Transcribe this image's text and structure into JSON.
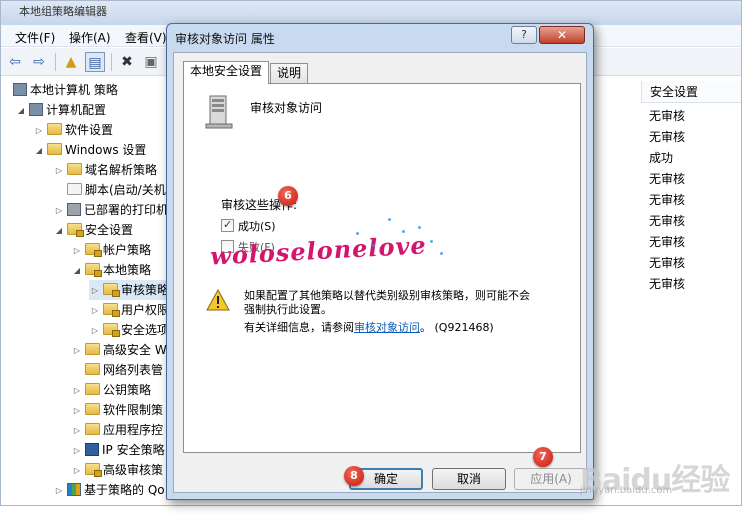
{
  "background_window": {
    "title": "本地组策略编辑器",
    "menu": [
      "文件(F)",
      "操作(A)",
      "查看(V)"
    ],
    "tree": [
      {
        "label": "本地计算机 策略",
        "level": 0,
        "icon": "computer-policy-icon"
      },
      {
        "label": "计算机配置",
        "level": 1,
        "icon": "computer-icon"
      },
      {
        "label": "软件设置",
        "level": 2,
        "icon": "folder-icon"
      },
      {
        "label": "Windows 设置",
        "level": 2,
        "icon": "folder-icon"
      },
      {
        "label": "域名解析策略",
        "level": 3,
        "icon": "folder-icon"
      },
      {
        "label": "脚本(启动/关机",
        "level": 3,
        "icon": "script-icon"
      },
      {
        "label": "已部署的打印机",
        "level": 3,
        "icon": "printer-icon"
      },
      {
        "label": "安全设置",
        "level": 3,
        "icon": "folder-lock-icon"
      },
      {
        "label": "帐户策略",
        "level": 4,
        "icon": "folder-lock-icon"
      },
      {
        "label": "本地策略",
        "level": 4,
        "icon": "folder-lock-icon"
      },
      {
        "label": "审核策略",
        "level": 5,
        "icon": "folder-lock-icon"
      },
      {
        "label": "用户权限",
        "level": 5,
        "icon": "folder-lock-icon"
      },
      {
        "label": "安全选项",
        "level": 5,
        "icon": "folder-lock-icon"
      },
      {
        "label": "高级安全 W",
        "level": 4,
        "icon": "folder-icon"
      },
      {
        "label": "网络列表管",
        "level": 4,
        "icon": "folder-icon"
      },
      {
        "label": "公钥策略",
        "level": 4,
        "icon": "folder-icon"
      },
      {
        "label": "软件限制策",
        "level": 4,
        "icon": "folder-icon"
      },
      {
        "label": "应用程序控",
        "level": 4,
        "icon": "folder-icon"
      },
      {
        "label": "IP 安全策略",
        "level": 4,
        "icon": "ip-security-icon"
      },
      {
        "label": "高级审核策",
        "level": 4,
        "icon": "folder-lock-icon"
      },
      {
        "label": "基于策略的 Qo",
        "level": 3,
        "icon": "chart-icon"
      }
    ],
    "column_header": "安全设置",
    "column_values": [
      "无审核",
      "无审核",
      "成功",
      "无审核",
      "无审核",
      "无审核",
      "无审核",
      "无审核",
      "无审核"
    ]
  },
  "dialog": {
    "title": "审核对象访问 属性",
    "help_label": "?",
    "close_label": "✕",
    "tabs": [
      "本地安全设置",
      "说明"
    ],
    "policy_name": "审核对象访问",
    "audit_label": "审核这些操作:",
    "success_label": "成功(S)",
    "failure_label": "失败(F)",
    "success_checked": true,
    "failure_checked": false,
    "warning_line1": "如果配置了其他策略以替代类别级别审核策略，则可能不会",
    "warning_line2": "强制执行此设置。",
    "info_prefix": "有关详细信息，请参阅",
    "info_link": "审核对象访问",
    "info_suffix": "。 (Q921468)",
    "ok_label": "确定",
    "cancel_label": "取消",
    "apply_label": "应用(A)"
  },
  "annotations": {
    "badge_6": "6",
    "badge_7": "7",
    "badge_8": "8",
    "watermark": "woloselonelove",
    "logo_text": "Baidu经验",
    "logo_url": "jingyan.baidu.com"
  }
}
